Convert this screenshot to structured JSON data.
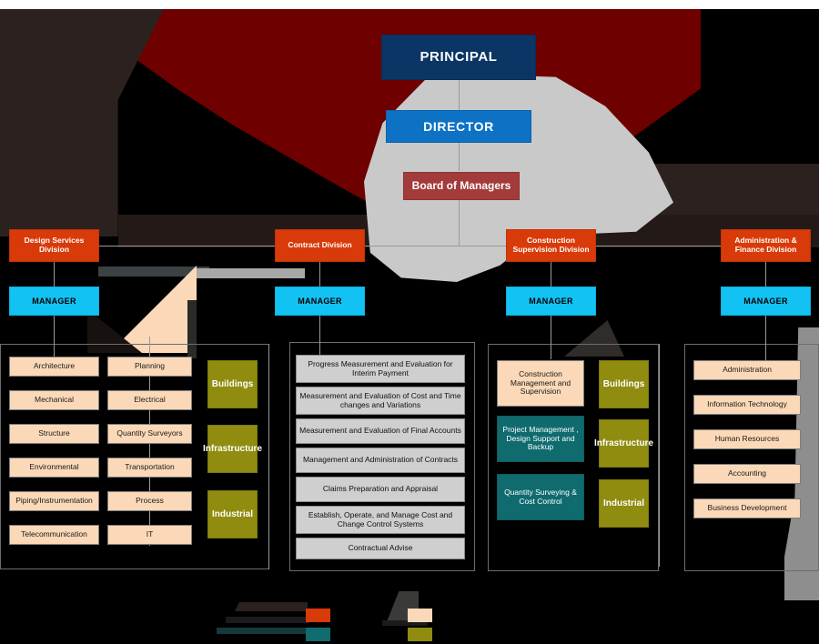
{
  "chart": {
    "type": "org-chart",
    "title": "",
    "background_color": "#000000"
  },
  "top_hierarchy": [
    {
      "id": "principal",
      "label": "PRINCIPAL",
      "color": "#0b3565"
    },
    {
      "id": "director",
      "label": "DIRECTOR",
      "color": "#0d72c4"
    },
    {
      "id": "board",
      "label": "Board of Managers",
      "color": "#a33b3b"
    }
  ],
  "divisions": [
    {
      "id": "design-services",
      "header": "Design Services\nDivision",
      "header_color": "#d93a09",
      "manager": "MANAGER",
      "manager_color": "#12c2f3",
      "columns": [
        {
          "style": "peach",
          "color": "#fbd9b8",
          "items": [
            "Architecture",
            "Mechanical",
            "Structure",
            "Environmental",
            "Piping/Instrumentation",
            "Telecommunication"
          ]
        },
        {
          "style": "peach",
          "color": "#fbd9b8",
          "items": [
            "Planning",
            "Electrical",
            "Quantity Surveyors",
            "Transportation",
            "Process",
            "IT"
          ]
        },
        {
          "style": "olive",
          "color": "#8f8c10",
          "items": [
            "Buildings",
            "Infrastructure",
            "Industrial"
          ]
        }
      ]
    },
    {
      "id": "contract-division",
      "header": "Contract  Division",
      "header_color": "#d93a09",
      "manager": "MANAGER",
      "manager_color": "#12c2f3",
      "columns": [
        {
          "style": "gray",
          "color": "#cfcfcf",
          "items": [
            "Progress Measurement  and Evaluation for Interim Payment",
            "Measurement  and Evaluation of Cost and Time changes and Variations",
            "Measurement  and Evaluation of Final Accounts",
            "Management  and Administration of Contracts",
            "Claims Preparation  and Appraisal",
            "Establish, Operate, and Manage  Cost and Change Control Systems",
            "Contractual Advise"
          ]
        }
      ]
    },
    {
      "id": "construction-supervision",
      "header": "Construction\nSupervision Division",
      "header_color": "#d93a09",
      "manager": "MANAGER",
      "manager_color": "#12c2f3",
      "columns": [
        {
          "style": "mixed",
          "items": [
            {
              "label": "Construction Management and Supervision",
              "style": "peach",
              "color": "#fbd9b8"
            },
            {
              "label": "Project Management , Design Support  and Backup",
              "style": "teal",
              "color": "#0f6b6e"
            },
            {
              "label": "Quantity Surveying & Cost Control",
              "style": "teal",
              "color": "#0f6b6e"
            }
          ]
        },
        {
          "style": "olive",
          "color": "#8f8c10",
          "items": [
            "Buildings",
            "Infrastructure",
            "Industrial"
          ]
        }
      ]
    },
    {
      "id": "administration-finance",
      "header": "Administration &\nFinance Division",
      "header_color": "#d93a09",
      "manager": "MANAGER",
      "manager_color": "#12c2f3",
      "columns": [
        {
          "style": "peach",
          "color": "#fbd9b8",
          "items": [
            "Administration",
            "Information Technology",
            "Human Resources",
            "Accounting",
            "Business Development"
          ]
        }
      ]
    }
  ],
  "legend_swatches": [
    {
      "id": "swatch-orange",
      "color": "#d93a09"
    },
    {
      "id": "swatch-teal",
      "color": "#0f6b6e"
    },
    {
      "id": "swatch-peach",
      "color": "#fbd9b8"
    },
    {
      "id": "swatch-olive",
      "color": "#8f8c10"
    }
  ]
}
